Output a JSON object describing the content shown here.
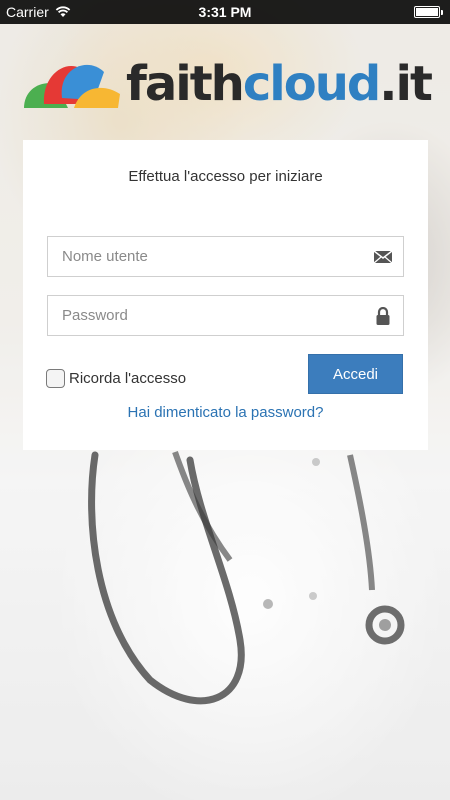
{
  "status_bar": {
    "carrier": "Carrier",
    "time": "3:31 PM",
    "battery_level": 1.0,
    "wifi_icon": "wifi-icon"
  },
  "logo": {
    "part1": "faith",
    "part2": "cloud",
    "part3": ".it",
    "colors": {
      "dark": "#2a2a2a",
      "blue": "#2f80c2",
      "green": "#4caf50",
      "red": "#e53935",
      "yellow": "#f7b733",
      "petal_blue": "#3a8fd6"
    }
  },
  "login": {
    "title": "Effettua l'accesso per iniziare",
    "username_placeholder": "Nome utente",
    "username_icon": "envelope-icon",
    "password_placeholder": "Password",
    "password_icon": "lock-icon",
    "remember_label": "Ricorda l'accesso",
    "remember_checked": false,
    "login_button": "Accedi",
    "forgot_link": "Hai dimenticato la password?"
  },
  "colors": {
    "accent": "#3c7dbd",
    "link": "#2b73b3"
  }
}
